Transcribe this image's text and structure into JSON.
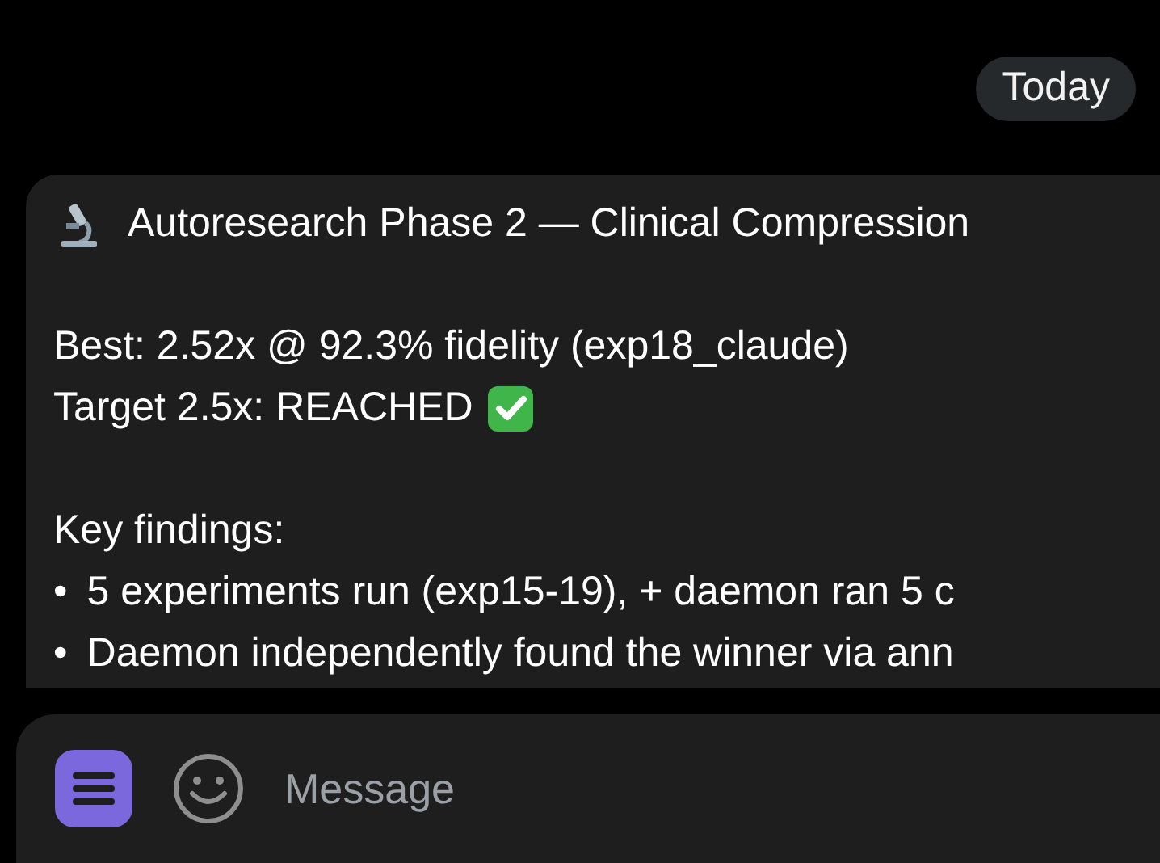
{
  "date_badge": "Today",
  "message": {
    "title": "Autoresearch Phase 2 — Clinical Compression",
    "lines": [
      {
        "kind": "blank"
      },
      {
        "kind": "text",
        "text": "Best: 2.52x @ 92.3% fidelity (exp18_claude)"
      },
      {
        "kind": "check",
        "text": "Target 2.5x: REACHED"
      },
      {
        "kind": "blank"
      },
      {
        "kind": "text",
        "text": "Key findings:"
      },
      {
        "kind": "bullet",
        "bullet": "•",
        "text": "5 experiments run (exp15-19), + daemon ran 5 c"
      },
      {
        "kind": "bullet",
        "bullet": "•",
        "text": "Daemon independently found the winner via ann"
      }
    ]
  },
  "composer": {
    "placeholder": "Message"
  }
}
